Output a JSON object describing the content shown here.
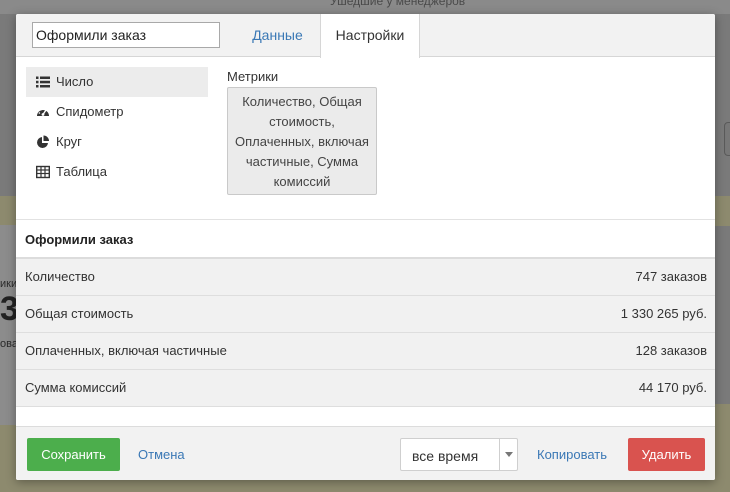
{
  "background": {
    "top_text": "Ушедшие у менеджеров",
    "left_text_1": "ики",
    "left_big": "3",
    "left_text_2": "ова"
  },
  "header": {
    "title_value": "Оформили заказ",
    "tabs": [
      {
        "label": "Данные",
        "active": false
      },
      {
        "label": "Настройки",
        "active": true
      }
    ]
  },
  "types": [
    {
      "label": "Число",
      "icon": "list-icon",
      "active": true
    },
    {
      "label": "Спидометр",
      "icon": "speedometer-icon",
      "active": false
    },
    {
      "label": "Круг",
      "icon": "pie-chart-icon",
      "active": false
    },
    {
      "label": "Таблица",
      "icon": "table-icon",
      "active": false
    }
  ],
  "metrics": {
    "label": "Метрики",
    "value": "Количество, Общая стоимость, Оплаченных, включая частичные, Сумма комиссий"
  },
  "preview": {
    "title": "Оформили заказ",
    "rows": [
      {
        "label": "Количество",
        "value": "747 заказов"
      },
      {
        "label": "Общая стоимость",
        "value": "1 330 265 руб."
      },
      {
        "label": "Оплаченных, включая частичные",
        "value": "128 заказов"
      },
      {
        "label": "Сумма комиссий",
        "value": "44 170 руб."
      }
    ]
  },
  "footer": {
    "save_label": "Сохранить",
    "cancel_label": "Отмена",
    "period_value": "все время",
    "copy_label": "Копировать",
    "delete_label": "Удалить"
  },
  "colors": {
    "save": "#4cae4c",
    "delete": "#d9534f",
    "link": "#3a78b5"
  }
}
